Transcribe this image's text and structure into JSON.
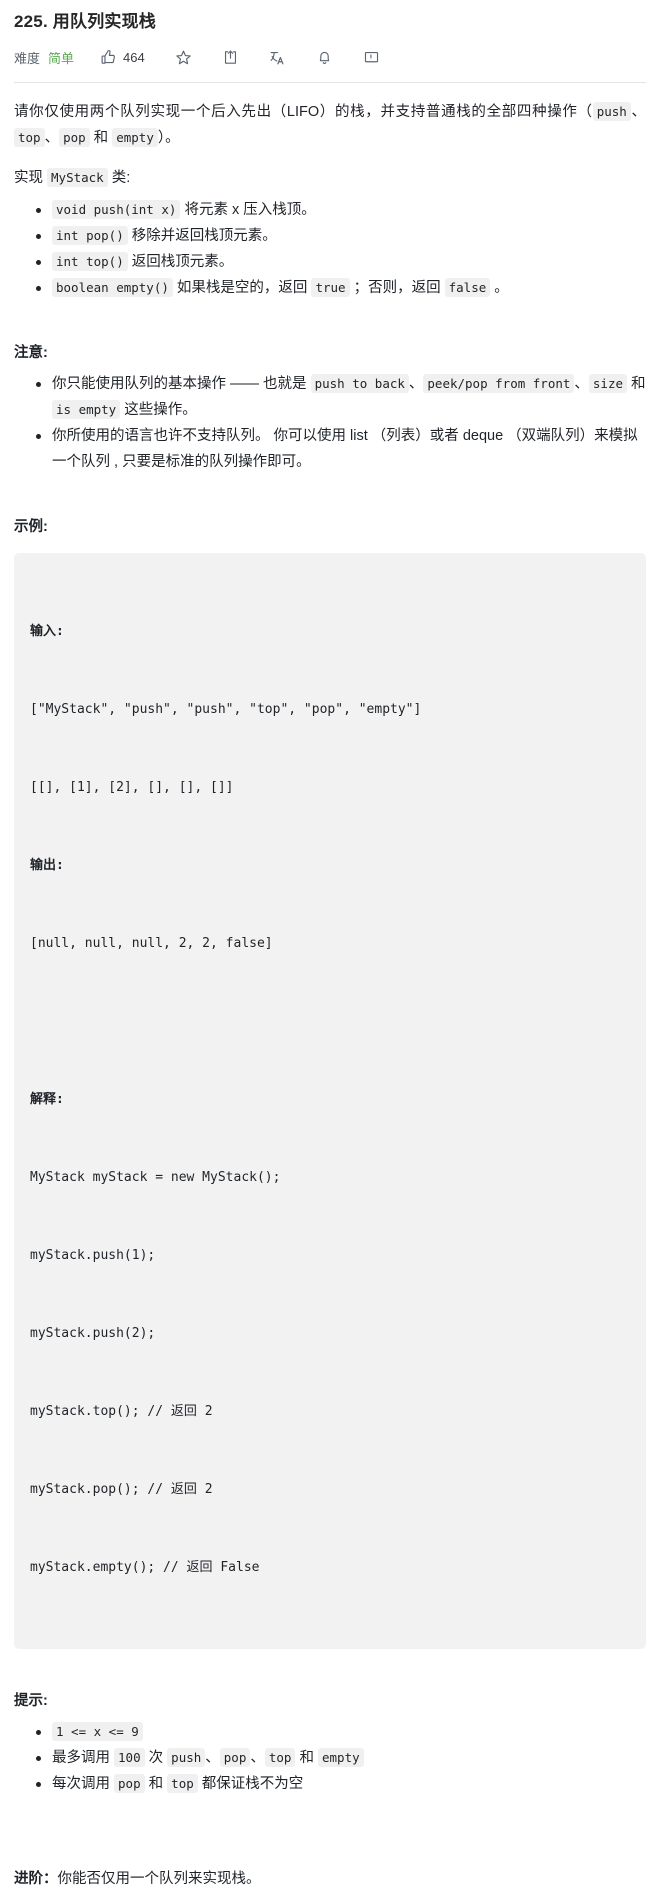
{
  "header": {
    "title": "225. 用队列实现栈",
    "difficulty_label": "难度",
    "difficulty_value": "简单",
    "difficulty_color": "#5eaa55",
    "likes_count": "464",
    "icons": {
      "thumbs_up": "thumbs-up-icon",
      "star": "star-icon",
      "share": "share-icon",
      "translate": "translate-icon",
      "bell": "bell-icon",
      "comment": "comment-icon"
    }
  },
  "description": {
    "p1_part1": "请你仅使用两个队列实现一个后入先出（LIFO）的栈，并支持普通栈的全部四种操作（",
    "p1_code1": "push",
    "p1_sep1": "、",
    "p1_code2": "top",
    "p1_sep2": "、",
    "p1_code3": "pop",
    "p1_and": " 和 ",
    "p1_code4": "empty",
    "p1_end": "）。",
    "p2_pre": "实现 ",
    "p2_code": "MyStack",
    "p2_post": " 类:"
  },
  "methods": [
    {
      "code": "void push(int x)",
      "text": " 将元素 x 压入栈顶。"
    },
    {
      "code": "int pop()",
      "text": " 移除并返回栈顶元素。"
    },
    {
      "code": "int top()",
      "text": " 返回栈顶元素。"
    },
    {
      "code": "boolean empty()",
      "text_pre": " 如果栈是空的，返回 ",
      "code_true": "true",
      "text_mid": " ；否则，返回 ",
      "code_false": "false",
      "text_post": " 。"
    }
  ],
  "notes": {
    "heading": "注意:",
    "item1_pre": "你只能使用队列的基本操作 —— 也就是 ",
    "item1_code1": "push to back",
    "item1_sep1": "、",
    "item1_code2": "peek/pop from front",
    "item1_sep2": "、",
    "item1_code3": "size",
    "item1_and": " 和 ",
    "item1_code4": "is empty",
    "item1_post": " 这些操作。",
    "item2": "你所使用的语言也许不支持队列。 你可以使用 list （列表）或者 deque （双端队列）来模拟一个队列 , 只要是标准的队列操作即可。"
  },
  "example": {
    "heading": "示例:",
    "input_label": "输入:",
    "input_line1": "[\"MyStack\", \"push\", \"push\", \"top\", \"pop\", \"empty\"]",
    "input_line2": "[[], [1], [2], [], [], []]",
    "output_label": "输出:",
    "output_line1": "[null, null, null, 2, 2, false]",
    "explain_label": "解释:",
    "explain_lines": [
      "MyStack myStack = new MyStack();",
      "myStack.push(1);",
      "myStack.push(2);",
      "myStack.top(); // 返回 2",
      "myStack.pop(); // 返回 2",
      "myStack.empty(); // 返回 False"
    ]
  },
  "hints": {
    "heading": "提示:",
    "item1_code": "1 <= x <= 9",
    "item2_pre": "最多调用 ",
    "item2_code1": "100",
    "item2_mid": " 次 ",
    "item2_code2": "push",
    "item2_sep1": "、",
    "item2_code3": "pop",
    "item2_sep2": "、",
    "item2_code4": "top",
    "item2_and": " 和 ",
    "item2_code5": "empty",
    "item3_pre": "每次调用 ",
    "item3_code1": "pop",
    "item3_and": " 和 ",
    "item3_code2": "top",
    "item3_post": " 都保证栈不为空"
  },
  "followup": {
    "label": "进阶：",
    "text": "你能否仅用一个队列来实现栈。"
  }
}
